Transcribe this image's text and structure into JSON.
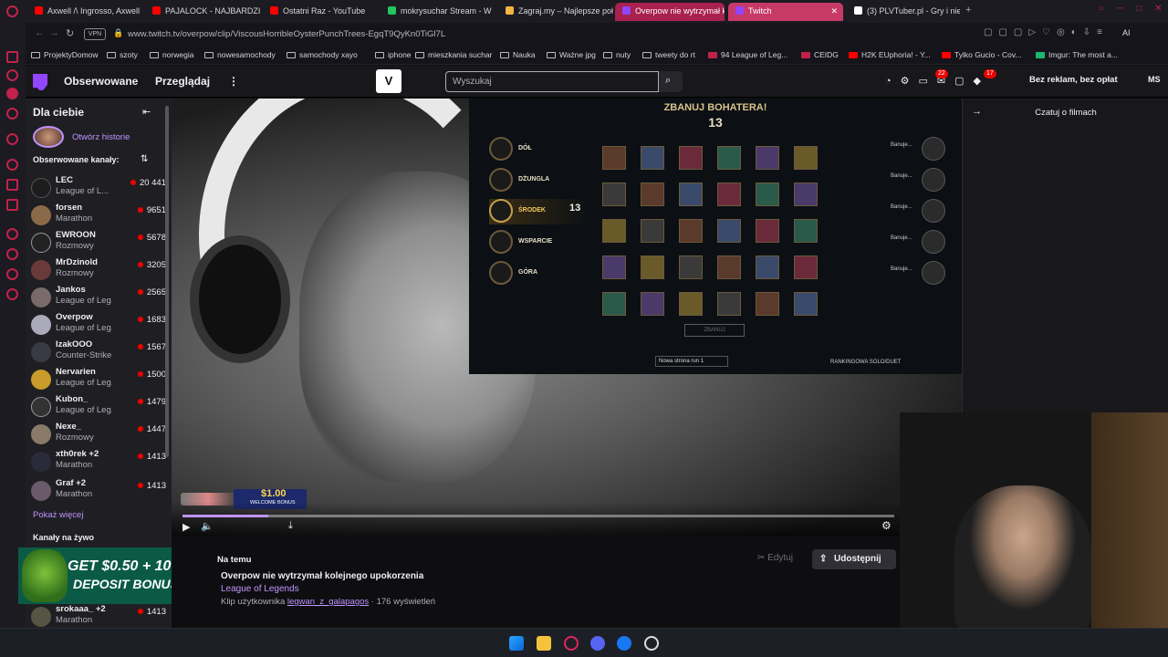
{
  "browser": {
    "tabs": [
      {
        "label": "Axwell /\\ Ingrosso, Axwell",
        "fav": "#ff0000"
      },
      {
        "label": "PAJALOCK - NAJBARDZIEJ",
        "fav": "#ff0000"
      },
      {
        "label": "Ostatni Raz - YouTube",
        "fav": "#ff0000"
      },
      {
        "label": "mokrysuchar Stream - W",
        "fav": "#22c55e"
      },
      {
        "label": "Zagraj.my – Najlepsze poł",
        "fav": "#f5b341"
      },
      {
        "label": "Overpow nie wytrzymał k",
        "fav": "#9146ff"
      },
      {
        "label": "Twitch",
        "fav": "#9146ff"
      },
      {
        "label": "(3) PLVTuber.pl - Gry i nie",
        "fav": "#ffffff"
      }
    ],
    "url": "www.twitch.tv/overpow/clip/ViscousHorribleOysterPunchTrees-EgqT9QyKn0TiGl7L",
    "vpn_label": "VPN",
    "bookmarks": [
      "ProjektyDomow",
      "szoty",
      "norwegia",
      "nowesamochody",
      "samochody xayo",
      "iphone",
      "mieszkania suchar",
      "Nauka",
      "Ważne jpg",
      "nuty",
      "tweety do rt",
      "94 League of Leg...",
      "CEIDG",
      "H2K EUphoria! - Y...",
      "Tylko Gucio - Cov...",
      "Imgur: The most a..."
    ]
  },
  "twitch_nav": {
    "following": "Obserwowane",
    "browse": "Przeglądaj",
    "more": "⋮",
    "vt_logo": "V",
    "search_placeholder": "Wyszukaj",
    "notif_badge_1": "22",
    "notif_badge_2": "17",
    "ad_free": "Bez reklam, bez opłat",
    "avatar": "MS"
  },
  "sidebar": {
    "title": "Dla ciebie",
    "story": "Otwórz historie",
    "followed_title": "Obserwowane kanały:",
    "channels": [
      {
        "name": "LEC",
        "game": "League of L...",
        "viewers": "20 441",
        "color": "#1d1d1d"
      },
      {
        "name": "forsen",
        "game": "Marathon",
        "viewers": "9651",
        "color": "#8b6a4a"
      },
      {
        "name": "EWROON",
        "game": "Rozmowy",
        "viewers": "5678",
        "color": "#222"
      },
      {
        "name": "MrDzinold",
        "game": "Rozmowy",
        "viewers": "3205",
        "color": "#6a3a3a"
      },
      {
        "name": "Jankos",
        "game": "League of Leg...",
        "viewers": "2565",
        "color": "#7a6a6a"
      },
      {
        "name": "Overpow",
        "game": "League of Leg...",
        "viewers": "1683",
        "color": "#aab"
      },
      {
        "name": "IzakOOO",
        "game": "Counter-Strike",
        "viewers": "1567",
        "color": "#3a3a44"
      },
      {
        "name": "Nervarien",
        "game": "League of Leg...",
        "viewers": "1500",
        "color": "#c89b2a"
      },
      {
        "name": "Kubon_",
        "game": "League of Leg...",
        "viewers": "1479",
        "color": "#333"
      },
      {
        "name": "Nexe_",
        "game": "Rozmowy",
        "viewers": "1447",
        "color": "#8a7a6a"
      },
      {
        "name": "xth0rek +2",
        "game": "Marathon",
        "viewers": "1413",
        "color": "#2a2a3a"
      },
      {
        "name": "Graf +2",
        "game": "Marathon",
        "viewers": "1413",
        "color": "#6a5a6a"
      }
    ],
    "show_more": "Pokaż więcej",
    "live_title": "Kanały na żywo",
    "last_channel": {
      "name": "srokaaa_ +2",
      "game": "Marathon",
      "viewers": "1413"
    }
  },
  "ad": {
    "line1": "GET $0.50 + 10%",
    "line2": "DEPOSIT BONUS"
  },
  "game_overlay": {
    "title": "ZBANUJ BOHATERA!",
    "timer": "13",
    "roles": [
      {
        "label": "DÓŁ",
        "sub": "Banuje..."
      },
      {
        "label": "DŻUNGLA",
        "sub": "Banuje..."
      },
      {
        "label": "ŚRODEK",
        "sub": "Banuje..."
      },
      {
        "label": "WSPARCIE",
        "sub": "Banuje..."
      },
      {
        "label": "GÓRA",
        "sub": "Banuje..."
      }
    ],
    "enemy_label": "Banuje...",
    "lock_label": "ZBANUJ",
    "rune_page": "Nowa strona run 1",
    "queue": "RANKINGOWA SOLO/DUET",
    "side_timer": "13"
  },
  "donation": {
    "amount": "$1.00",
    "sub": "WELCOME BONUS"
  },
  "player": {
    "progress": 0.12
  },
  "chat": {
    "title": "Czatuj o filmach",
    "collapse_icon": "→"
  },
  "clip_info": {
    "category": "Na temu",
    "title": "Overpow nie wytrzymał kolejnego upokorzenia",
    "game": "League of Legends",
    "by_prefix": "Klip użytkownika",
    "clipper": "legwan_z_galapagos",
    "views": "· 176 wyświetleń",
    "edit": "Edytuj",
    "share": "Udostępnij"
  }
}
